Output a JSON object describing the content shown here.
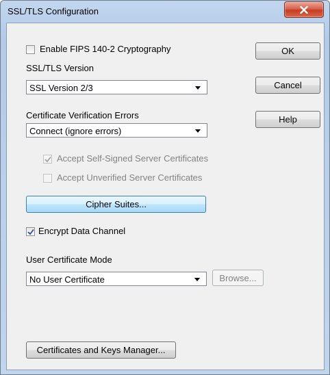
{
  "window": {
    "title": "SSL/TLS Configuration"
  },
  "fips": {
    "label": "Enable FIPS 140-2 Cryptography",
    "checked": false
  },
  "ssl_version": {
    "label": "SSL/TLS Version",
    "selected": "SSL Version 2/3"
  },
  "cert_errors": {
    "label": "Certificate Verification Errors",
    "selected": "Connect (ignore errors)"
  },
  "accept_self_signed": {
    "label": "Accept Self-Signed Server Certificates",
    "checked": true,
    "enabled": false
  },
  "accept_unverified": {
    "label": "Accept Unverified Server Certificates",
    "checked": false,
    "enabled": false
  },
  "cipher_suites_button": "Cipher Suites...",
  "encrypt_data": {
    "label": "Encrypt Data Channel",
    "checked": true
  },
  "user_cert_mode": {
    "label": "User Certificate Mode",
    "selected": "No User Certificate"
  },
  "browse_button": "Browse...",
  "cert_manager_button": "Certificates and Keys Manager...",
  "buttons": {
    "ok": "OK",
    "cancel": "Cancel",
    "help": "Help"
  }
}
